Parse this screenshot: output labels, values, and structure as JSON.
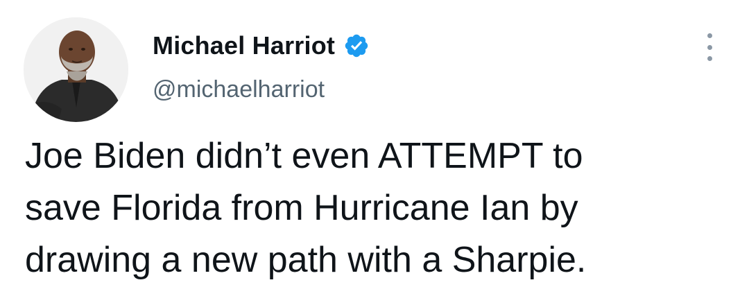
{
  "tweet": {
    "author": {
      "display_name": "Michael Harriot",
      "handle": "@michaelharriot",
      "verified": true,
      "avatar_icon": "profile-photo"
    },
    "text": "Joe Biden didn’t even ATTEMPT to\nsave Florida from Hurricane Ian by\ndrawing a new path with a Sharpie.",
    "more_icon": "more-options-icon"
  },
  "colors": {
    "text": "#0f1419",
    "secondary": "#536471",
    "verified_blue": "#1d9bf0",
    "more_dots": "#8b98a5"
  }
}
